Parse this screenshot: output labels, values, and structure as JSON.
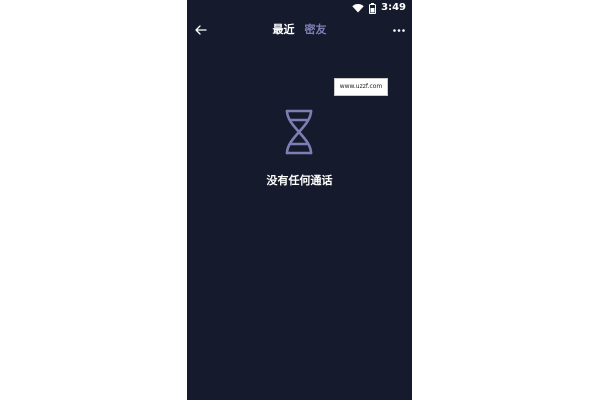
{
  "status_bar": {
    "time": "3:49",
    "icons": [
      "wifi-icon",
      "battery-icon"
    ]
  },
  "app_bar": {
    "back_icon": "arrow-left-icon",
    "tabs": [
      {
        "label": "最近",
        "active": true
      },
      {
        "label": "密友",
        "active": false
      }
    ],
    "more_icon": "more-dots-icon"
  },
  "watermark": {
    "text": "www.uzzf.com"
  },
  "empty_state": {
    "icon": "dna-icon",
    "message": "没有任何通话"
  },
  "colors": {
    "background": "#151a2c",
    "active_tab": "#ffffff",
    "inactive_tab": "#7d7fb3",
    "icon_stroke": "#7d7fb3"
  }
}
